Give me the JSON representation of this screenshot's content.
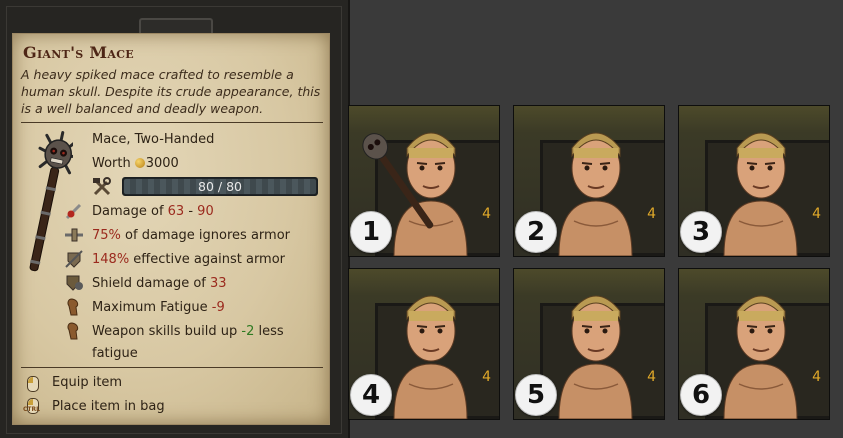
{
  "tooltip": {
    "title": "Giant's Mace",
    "description": "A heavy spiked mace crafted to resemble a human skull. Despite its crude appearance, this is a well balanced and deadly weapon.",
    "type": "Mace, Two-Handed",
    "worth_label": "Worth",
    "worth_value": "3000",
    "durability": {
      "text": "80 / 80",
      "current": 80,
      "max": 80
    },
    "stats": [
      {
        "icon": "damage-icon",
        "pre": "Damage of ",
        "v1": "63",
        "mid": " - ",
        "v2": "90",
        "post": ""
      },
      {
        "icon": "armor-ignore-icon",
        "v1": "75%",
        "post": " of damage ignores armor"
      },
      {
        "icon": "armor-effect-icon",
        "v1": "148%",
        "post": " effective against armor"
      },
      {
        "icon": "shield-damage-icon",
        "pre": "Shield damage of ",
        "v1": "33"
      },
      {
        "icon": "fatigue-icon",
        "pre": "Maximum Fatigue ",
        "v1": "-9"
      },
      {
        "icon": "fatigue-icon",
        "pre": "Weapon skills build up ",
        "v1": "-2",
        "post": " less fatigue"
      }
    ],
    "hints": [
      {
        "icon": "mouse-left-icon",
        "label": "Equip item"
      },
      {
        "icon": "mouse-ctrl-icon",
        "label": "Place item in bag",
        "key": "CTRL"
      }
    ]
  },
  "cards": [
    {
      "badge": "1",
      "count": "4",
      "holding_mace": true
    },
    {
      "badge": "2",
      "count": "4",
      "holding_mace": false
    },
    {
      "badge": "3",
      "count": "4",
      "holding_mace": false
    },
    {
      "badge": "4",
      "count": "4",
      "holding_mace": false
    },
    {
      "badge": "5",
      "count": "4",
      "holding_mace": false
    },
    {
      "badge": "6",
      "count": "4",
      "holding_mace": false
    }
  ],
  "colors": {
    "parchment": "#d8c8a3",
    "title": "#4e2616",
    "negative": "#9b2a1e",
    "positive": "#2f7a22",
    "count": "#e0a829"
  }
}
